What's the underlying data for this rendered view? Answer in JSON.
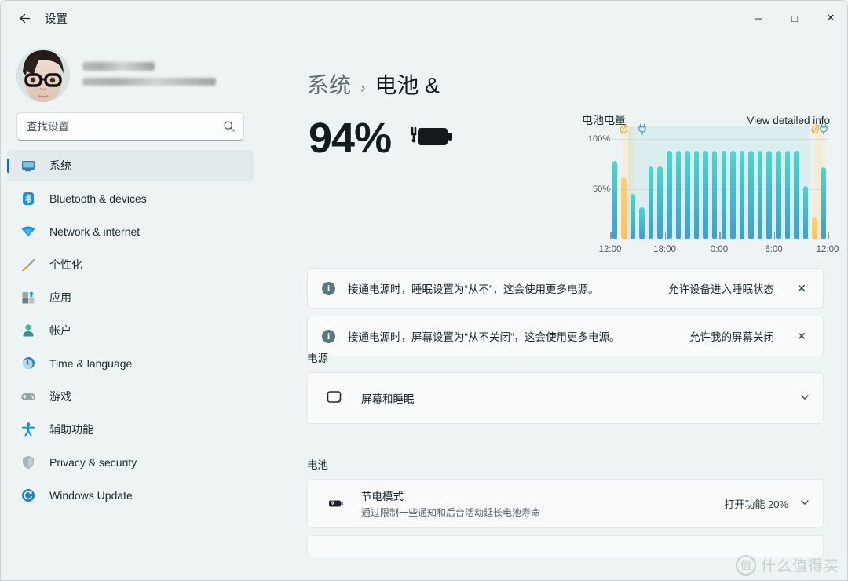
{
  "window": {
    "title": "设置",
    "back_icon": "back-arrow-icon",
    "minimize_label": "─",
    "maximize_label": "□",
    "close_label": "✕"
  },
  "sidebar": {
    "account": {
      "avatar_alt": "user-avatar",
      "name_redacted": true,
      "email_redacted": true
    },
    "search": {
      "placeholder": "查找设置",
      "value": "",
      "icon": "search-icon"
    },
    "items": [
      {
        "label": "系统",
        "icon": "monitor-icon",
        "active": true
      },
      {
        "label": "Bluetooth & devices",
        "icon": "bluetooth-icon",
        "active": false
      },
      {
        "label": "Network & internet",
        "icon": "wifi-icon",
        "active": false
      },
      {
        "label": "个性化",
        "icon": "paintbrush-icon",
        "active": false
      },
      {
        "label": "应用",
        "icon": "apps-icon",
        "active": false
      },
      {
        "label": "帐户",
        "icon": "account-icon",
        "active": false
      },
      {
        "label": "Time & language",
        "icon": "clock-icon",
        "active": false
      },
      {
        "label": "游戏",
        "icon": "gamepad-icon",
        "active": false
      },
      {
        "label": "辅助功能",
        "icon": "accessibility-icon",
        "active": false
      },
      {
        "label": "Privacy & security",
        "icon": "shield-icon",
        "active": false
      },
      {
        "label": "Windows Update",
        "icon": "update-icon",
        "active": false
      }
    ]
  },
  "main": {
    "breadcrumb": {
      "parent": "系统",
      "separator": "›",
      "current": "电池 &"
    },
    "battery": {
      "percent_label": "94%",
      "icon": "battery-charging-icon"
    },
    "banners": [
      {
        "icon": "info-icon",
        "badge": "i",
        "text": "接通电源时，睡眠设置为“从不”，这会使用更多电源。",
        "action": "允许设备进入睡眠状态",
        "close_label": "✕"
      },
      {
        "icon": "info-icon",
        "badge": "i",
        "text": "接通电源时，屏幕设置为“从不关闭”，这会使用更多电源。",
        "action": "允许我的屏幕关闭",
        "close_label": "✕"
      }
    ],
    "sections": [
      {
        "title": "电源",
        "rows": [
          {
            "icon": "screen-sleep-icon",
            "title": "屏幕和睡眠",
            "sub": "",
            "value": "",
            "chevron": "⌄"
          }
        ]
      },
      {
        "title": "电池",
        "rows": [
          {
            "icon": "battery-saver-icon",
            "title": "节电模式",
            "sub": "通过限制一些通知和后台活动延长电池寿命",
            "value": "打开功能 20%",
            "chevron": "⌄"
          }
        ]
      }
    ]
  },
  "chart_data": {
    "type": "bar",
    "title": "电池电量",
    "link_label": "View detailed info",
    "xlabel": "",
    "ylabel": "",
    "ylim": [
      0,
      100
    ],
    "ytick_labels": [
      "100%",
      "50%"
    ],
    "yticks": [
      100,
      50
    ],
    "grid": true,
    "legend_position": "none",
    "x_tick_labels": [
      "12:00",
      "18:00",
      "0:00",
      "6:00",
      "12:00"
    ],
    "x_tick_positions": [
      0,
      6,
      12,
      18,
      24
    ],
    "series": [
      {
        "name": "电池电量",
        "values": [
          78,
          62,
          45,
          32,
          73,
          73,
          88,
          88,
          88,
          88,
          88,
          88,
          88,
          88,
          88,
          88,
          88,
          88,
          88,
          88,
          88,
          53,
          22,
          72
        ]
      }
    ],
    "bar_colors": [
      "teal",
      "amber",
      "teal",
      "teal",
      "teal",
      "teal",
      "teal",
      "teal",
      "teal",
      "teal",
      "teal",
      "teal",
      "teal",
      "teal",
      "teal",
      "teal",
      "teal",
      "teal",
      "teal",
      "teal",
      "teal",
      "teal",
      "amber",
      "teal"
    ],
    "color_teal_top": "#4ed8cd",
    "color_teal_bottom": "#3d9fd0",
    "color_amber": "#ffd073",
    "annotations": [
      {
        "icon": "leaf-icon",
        "label": "battery-saver",
        "x_index": 1,
        "color": "#e8b13c"
      },
      {
        "icon": "plug-icon",
        "label": "plugged-in",
        "x_index": 3,
        "color": "#3aa9bd"
      },
      {
        "icon": "leaf-icon",
        "label": "battery-saver",
        "x_index": 22,
        "color": "#e8b13c"
      },
      {
        "icon": "plug-icon",
        "label": "plugged-in",
        "x_index": 23,
        "color": "#3aa9bd"
      }
    ],
    "bands": [
      {
        "type": "saver",
        "start_index": 1,
        "end_index": 2
      },
      {
        "type": "charging",
        "start_index": 2,
        "end_index": 21
      },
      {
        "type": "saver",
        "start_index": 22,
        "end_index": 23
      }
    ]
  },
  "watermark": {
    "mark": "值",
    "text": "什么值得买"
  }
}
